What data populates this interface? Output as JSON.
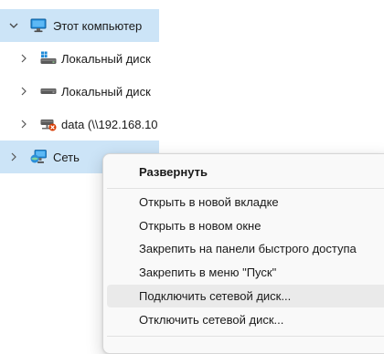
{
  "tree": {
    "items": [
      {
        "label": "Этот компьютер",
        "icon": "monitor-icon",
        "expanded": true,
        "selected": true
      },
      {
        "label": "Локальный диск",
        "icon": "windows-drive-icon",
        "expanded": false,
        "selected": false
      },
      {
        "label": "Локальный диск",
        "icon": "hard-drive-icon",
        "expanded": false,
        "selected": false
      },
      {
        "label": "data (\\\\192.168.10",
        "icon": "disconnected-network-drive-icon",
        "expanded": false,
        "selected": false
      },
      {
        "label": "Сеть",
        "icon": "network-icon",
        "expanded": false,
        "selected": true
      }
    ]
  },
  "context_menu": {
    "items": [
      {
        "label": "Развернуть",
        "bold": true
      },
      {
        "label": "Открыть в новой вкладке"
      },
      {
        "label": "Открыть в новом окне"
      },
      {
        "label": "Закрепить на панели быстрого доступа"
      },
      {
        "label": "Закрепить в меню \"Пуск\""
      },
      {
        "label": "Подключить сетевой диск...",
        "hovered": true
      },
      {
        "label": "Отключить сетевой диск..."
      }
    ]
  },
  "colors": {
    "selection": "#cce4f7",
    "menu_background": "#f9f9f9",
    "menu_hover": "#eaeaea",
    "disconnect_mark": "#d83b01",
    "accent_blue": "#0078d4"
  }
}
